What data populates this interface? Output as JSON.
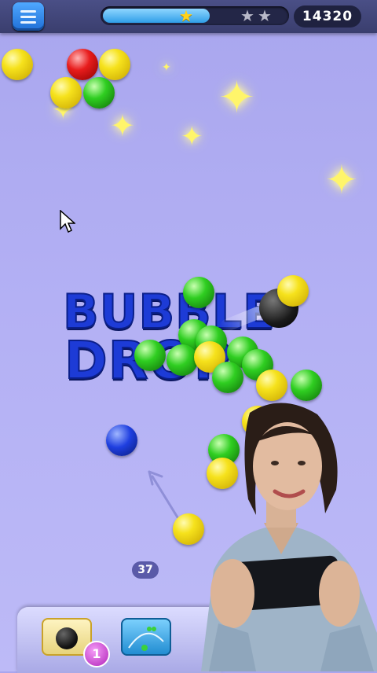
{
  "game": {
    "title": "BUBBLE DROP",
    "title_line1": "BUBBLE",
    "title_line2": "DROP",
    "score": "14320",
    "progress": 0.58,
    "stars_earned": 1,
    "stars_total": 3,
    "shots_left": "37",
    "bomb_count": "1"
  },
  "icons": {
    "menu": "hamburger-menu-icon",
    "star": "star-icon",
    "bomb": "bomb-icon",
    "aim_tool": "aim-line-icon"
  },
  "colors": {
    "bubble_yellow": "#f6e21c",
    "bubble_red": "#e81c1c",
    "bubble_green": "#2fce21",
    "bubble_blue": "#1f3fe0",
    "topbar": "#3a3e6e",
    "accent": "#2f9ee8"
  }
}
